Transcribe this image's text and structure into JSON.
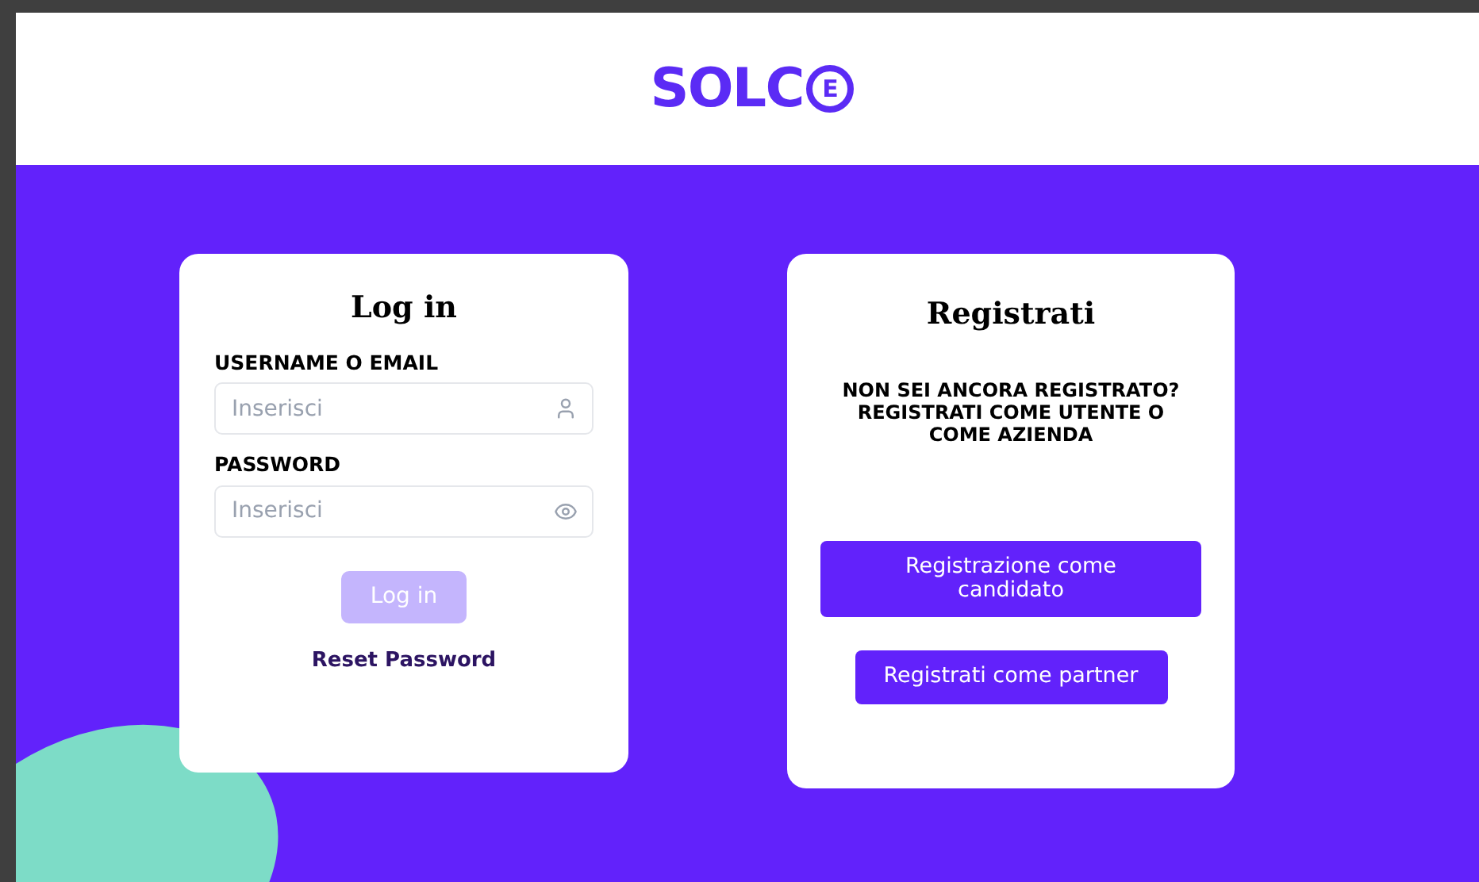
{
  "header": {
    "logo_text": "SOLC",
    "logo_badge": "E"
  },
  "login": {
    "title": "Log in",
    "fields": [
      {
        "label": "USERNAME O EMAIL",
        "placeholder": "Inserisci",
        "kind": "user"
      },
      {
        "label": "PASSWORD",
        "placeholder": "Inserisci",
        "kind": "password"
      }
    ],
    "submit": {
      "label": "Log in",
      "disabled": true
    },
    "reset_link": "Reset Password"
  },
  "register": {
    "title": "Registrati",
    "message": "NON SEI ANCORA REGISTRATO? REGISTRATI COME UTENTE O COME AZIENDA",
    "buttons": [
      {
        "label": "Registrazione come candidato",
        "kind": "wide"
      },
      {
        "label": "Registrati come partner",
        "kind": "narrow"
      }
    ]
  }
}
